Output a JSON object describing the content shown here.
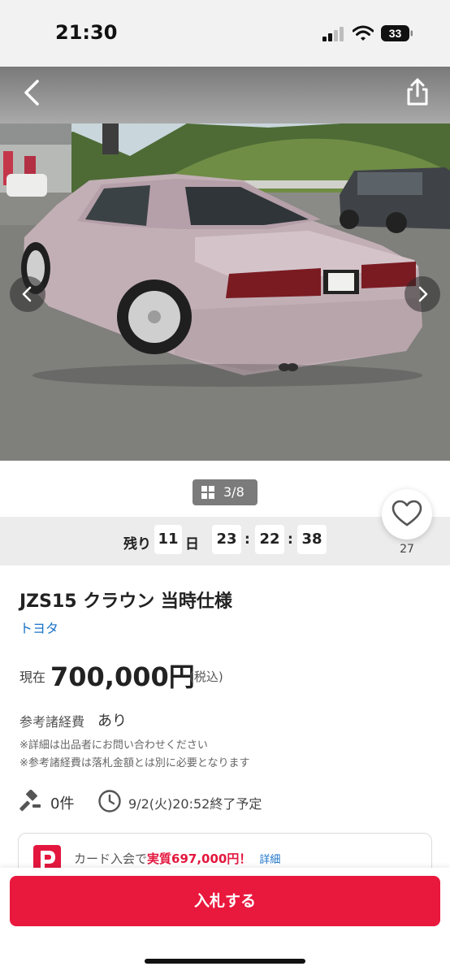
{
  "status_bar": {
    "time": "21:30",
    "battery": "33"
  },
  "gallery": {
    "counter": "3/8"
  },
  "timer": {
    "prefix": "残り",
    "days": "11",
    "days_unit": "日",
    "hours": "23",
    "minutes": "22",
    "seconds": "38",
    "separator": ":"
  },
  "watch": {
    "count": "27"
  },
  "item": {
    "title": "JZS15 クラウン 当時仕様",
    "maker": "トヨタ",
    "price_label": "現在",
    "price": "700,000円",
    "price_tax": "(税込)",
    "fee_label": "参考諸経費",
    "fee_value": "あり",
    "note1": "※詳細は出品者にお問い合わせください",
    "note2": "※参考諸経費は落札金額とは別に必要となります",
    "bids": "0件",
    "end_time": "9/2(火)20:52終了予定"
  },
  "promo": {
    "text": "カード入会で",
    "highlight": "実質697,000円！",
    "link": "詳細"
  },
  "action": {
    "bid_label": "入札する"
  },
  "colors": {
    "accent": "#e9183d",
    "link": "#1a73c9"
  }
}
